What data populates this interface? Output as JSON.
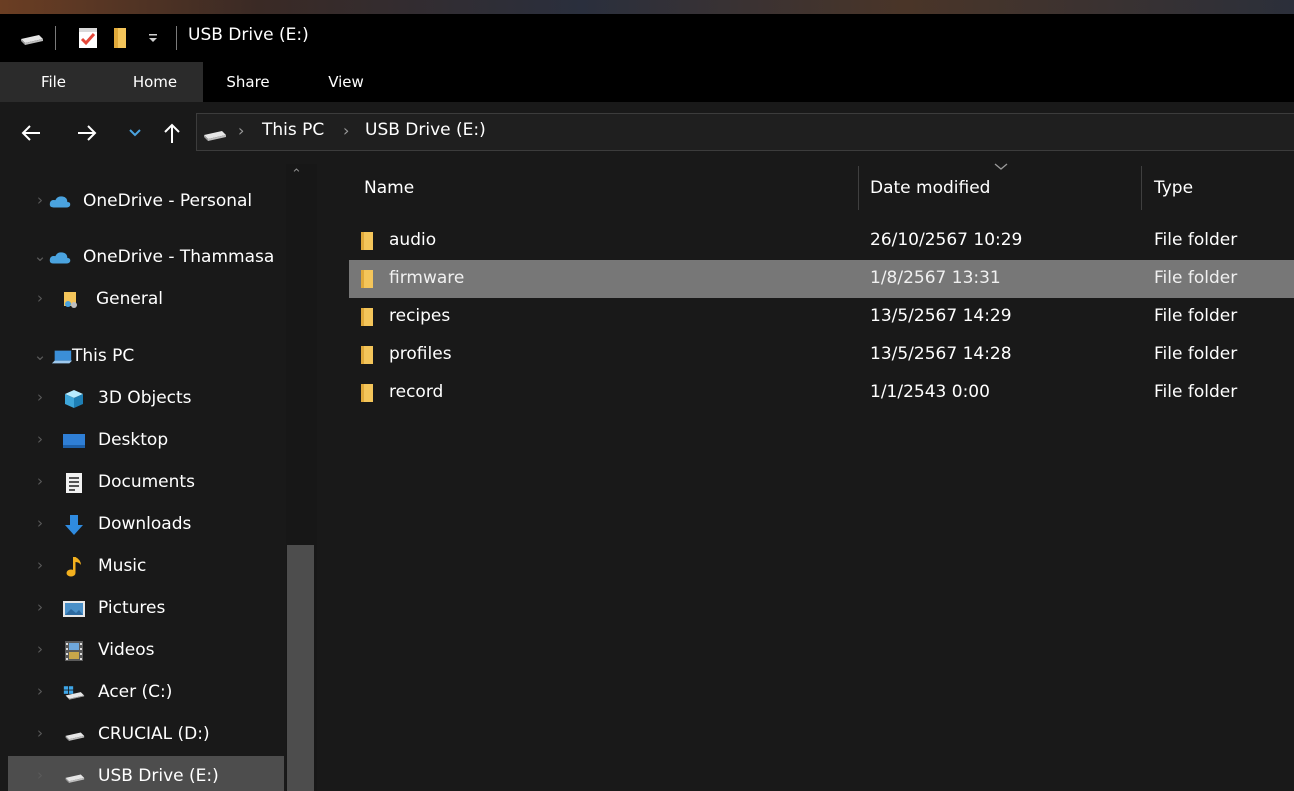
{
  "window": {
    "title": "USB Drive (E:)"
  },
  "ribbon_tabs": [
    {
      "label": "File"
    },
    {
      "label": "Home"
    },
    {
      "label": "Share"
    },
    {
      "label": "View"
    }
  ],
  "breadcrumb": [
    {
      "label": "This PC"
    },
    {
      "label": "USB Drive (E:)"
    }
  ],
  "nav": {
    "items": [
      {
        "label": "OneDrive - Personal",
        "icon": "cloud-icon"
      },
      {
        "label": "OneDrive - Thammasa",
        "icon": "cloud-icon"
      },
      {
        "label": "General",
        "icon": "shared-folder-icon"
      },
      {
        "label": "This PC",
        "icon": "computer-icon"
      },
      {
        "label": "3D Objects",
        "icon": "cube-icon"
      },
      {
        "label": "Desktop",
        "icon": "desktop-icon"
      },
      {
        "label": "Documents",
        "icon": "document-icon"
      },
      {
        "label": "Downloads",
        "icon": "download-icon"
      },
      {
        "label": "Music",
        "icon": "music-icon"
      },
      {
        "label": "Pictures",
        "icon": "picture-icon"
      },
      {
        "label": "Videos",
        "icon": "video-icon"
      },
      {
        "label": "Acer (C:)",
        "icon": "windows-drive-icon"
      },
      {
        "label": "CRUCIAL (D:)",
        "icon": "drive-icon"
      },
      {
        "label": "USB Drive (E:)",
        "icon": "drive-icon"
      }
    ]
  },
  "columns": {
    "name": "Name",
    "date": "Date modified",
    "type": "Type"
  },
  "files": [
    {
      "name": "audio",
      "date": "26/10/2567 10:29",
      "type": "File folder"
    },
    {
      "name": "firmware",
      "date": "1/8/2567 13:31",
      "type": "File folder"
    },
    {
      "name": "recipes",
      "date": "13/5/2567 14:29",
      "type": "File folder"
    },
    {
      "name": "profiles",
      "date": "13/5/2567 14:28",
      "type": "File folder"
    },
    {
      "name": "record",
      "date": "1/1/2543 0:00",
      "type": "File folder"
    }
  ],
  "colors": {
    "folder": "#f4c55a",
    "selection": "#777777",
    "nav_selection": "#4d4d4d",
    "accent": "#4aa3df"
  }
}
